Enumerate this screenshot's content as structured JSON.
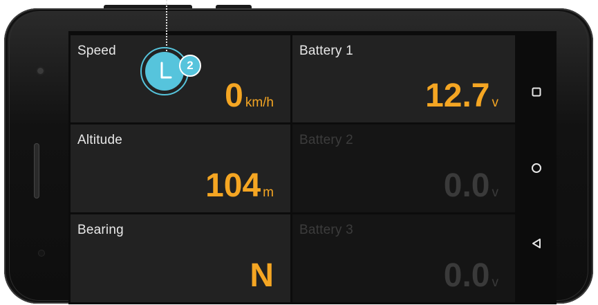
{
  "tiles": [
    {
      "label": "Speed",
      "value": "0",
      "unit": "km/h",
      "active": true
    },
    {
      "label": "Battery 1",
      "value": "12.7",
      "unit": "v",
      "active": true
    },
    {
      "label": "Altitude",
      "value": "104",
      "unit": "m",
      "active": true
    },
    {
      "label": "Battery 2",
      "value": "0.0",
      "unit": "v",
      "active": false
    },
    {
      "label": "Bearing",
      "value": "N",
      "unit": "",
      "active": true
    },
    {
      "label": "Battery 3",
      "value": "0.0",
      "unit": "v",
      "active": false
    }
  ],
  "hint": {
    "step": "2",
    "icon": "clock-icon"
  },
  "navbar": {
    "icons": [
      "recents-square-icon",
      "home-circle-icon",
      "back-triangle-icon"
    ]
  },
  "colors": {
    "accent": "#f5a623",
    "hint": "#56c4dc",
    "tile_active": "#222222",
    "tile_dim": "#151515",
    "label": "#e8e8e8",
    "label_dim": "#3c3c3c"
  }
}
